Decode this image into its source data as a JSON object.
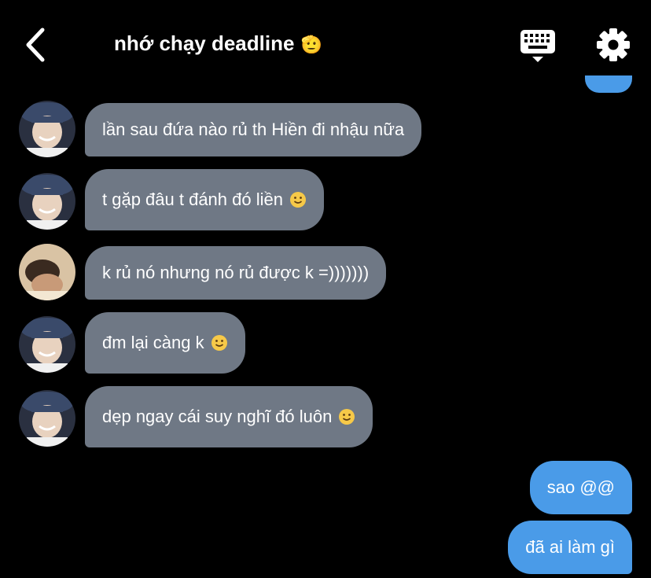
{
  "header": {
    "title": "nhớ chạy deadline",
    "title_emoji": "🫡",
    "back_icon": "chevron-left-icon",
    "keyboard_icon": "keyboard-icon",
    "settings_icon": "gear-icon"
  },
  "messages": [
    {
      "side": "in",
      "avatar": "avatar-bucket-hat",
      "text": "lần sau đứa nào rủ th Hiền đi nhậu nữa",
      "emoji": ""
    },
    {
      "side": "in",
      "avatar": "avatar-bucket-hat",
      "text": "t gặp đâu t đánh đó liền",
      "emoji": "🙂"
    },
    {
      "side": "in",
      "avatar": "avatar-lying-down",
      "text": "k rủ nó nhưng nó rủ được k =)))))))",
      "emoji": ""
    },
    {
      "side": "in",
      "avatar": "avatar-bucket-hat",
      "text": "đm lại càng k",
      "emoji": "🙂"
    },
    {
      "side": "in",
      "avatar": "avatar-bucket-hat",
      "text": "dẹp ngay cái suy nghĩ đó luôn",
      "emoji": "🙂"
    },
    {
      "side": "out",
      "text": "sao @@"
    },
    {
      "side": "out",
      "text": "đã ai làm gì"
    }
  ],
  "colors": {
    "background": "#000000",
    "incoming_bubble": "#6f7885",
    "outgoing_bubble": "#4a9be8",
    "text": "#ffffff"
  }
}
